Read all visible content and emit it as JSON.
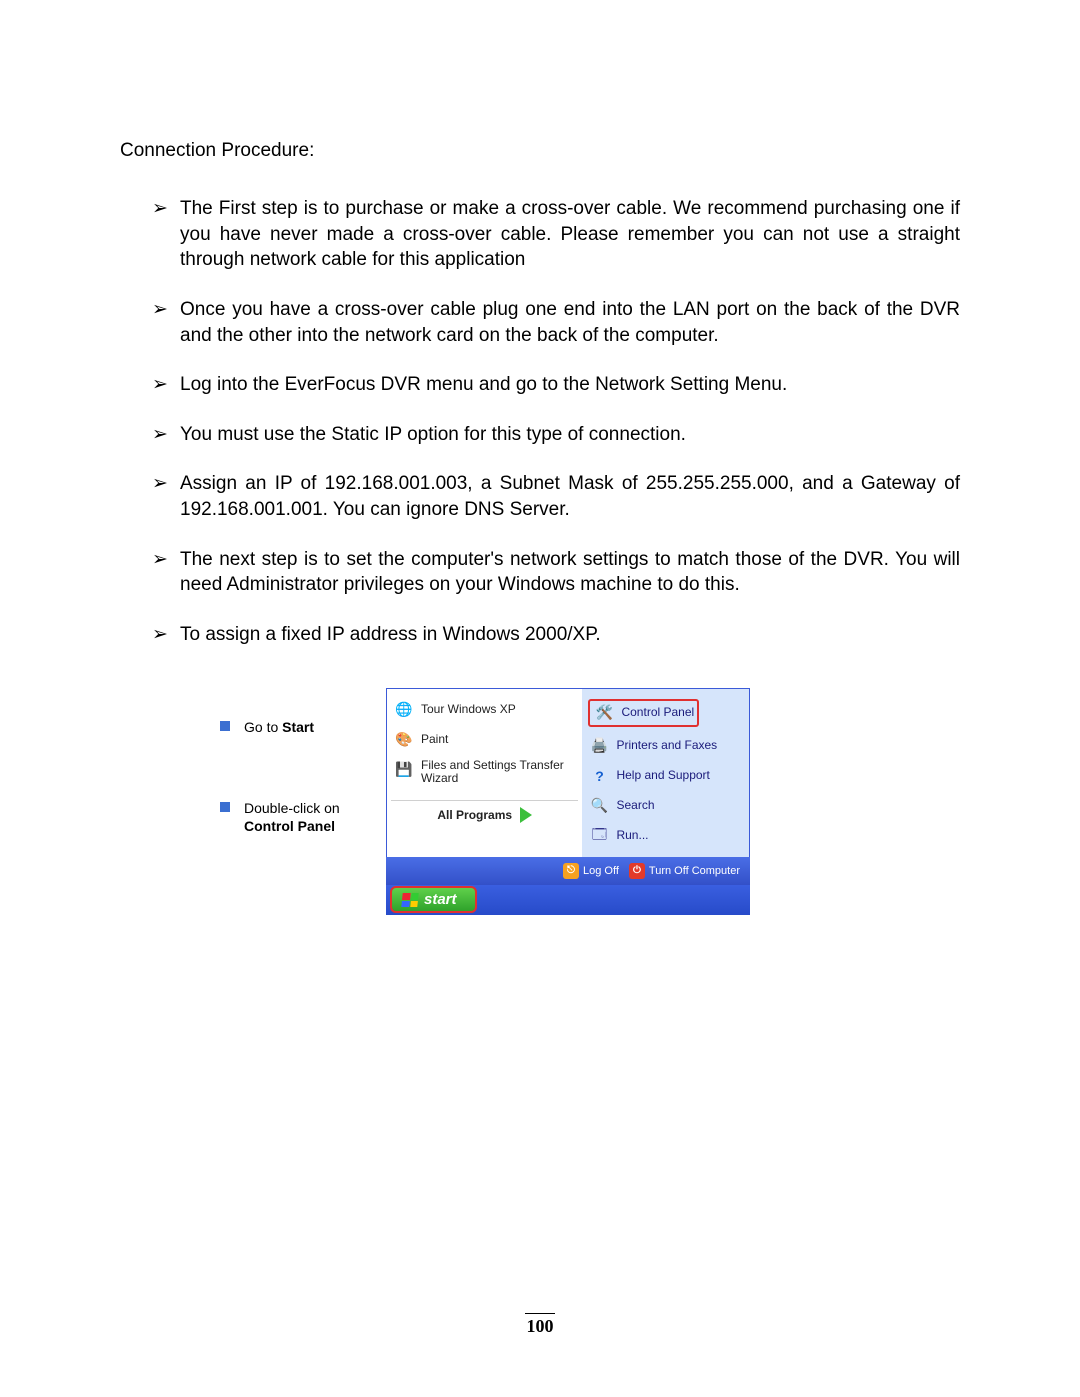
{
  "heading": "Connection Procedure:",
  "bullets": [
    "The First step is to purchase or make a cross-over cable. We recommend purchasing one if you have never made a cross-over cable. Please remember you can not use a straight through network cable for this application",
    "Once you have a cross-over cable plug one end into the LAN port on the back of the DVR and the other into the network card on the back of the computer.",
    "Log into the EverFocus DVR menu and go to the Network Setting Menu.",
    "You must use the Static IP option for this type of connection.",
    "Assign an IP of 192.168.001.003, a Subnet Mask of 255.255.255.000, and a Gateway of 192.168.001.001. You can ignore DNS Server.",
    "The next step is to set the computer's network settings to match those of the DVR. You will need Administrator privileges on your Windows machine to do this.",
    "To assign a fixed IP address in Windows 2000/XP."
  ],
  "instructions": {
    "i1_pre": "Go to ",
    "i1_b": "Start",
    "i2_pre": "Double-click on",
    "i2_b": "Control Panel"
  },
  "startmenu": {
    "left": {
      "tour": "Tour Windows XP",
      "paint": "Paint",
      "fstw": "Files and Settings Transfer Wizard",
      "allprograms": "All Programs"
    },
    "right": {
      "controlpanel": "Control Panel",
      "printers": "Printers and Faxes",
      "help": "Help and Support",
      "search": "Search",
      "run": "Run..."
    },
    "footer": {
      "logoff": "Log Off",
      "turnoff": "Turn Off Computer"
    },
    "startbtn": "start"
  },
  "pagenum": "100"
}
